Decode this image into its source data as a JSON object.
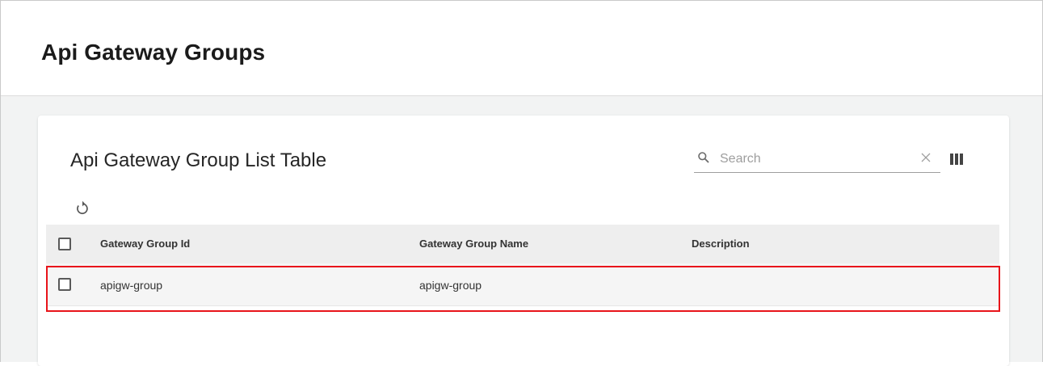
{
  "page": {
    "title": "Api Gateway Groups"
  },
  "card": {
    "title": "Api Gateway Group List Table"
  },
  "toolbar": {
    "search_placeholder": "Search",
    "search_value": "",
    "search_icon": "search-icon",
    "clear_icon": "close-icon",
    "columns_icon": "view-column-icon",
    "refresh_icon": "refresh-icon"
  },
  "table": {
    "columns": [
      "Gateway Group Id",
      "Gateway Group Name",
      "Description"
    ],
    "rows": [
      {
        "checked": false,
        "cells": [
          "apigw-group",
          "apigw-group",
          ""
        ]
      }
    ]
  },
  "colors": {
    "highlight": "#e8141a",
    "header_bg": "#eeeeee",
    "row_bg": "#f5f5f5",
    "page_bg": "#f2f3f3"
  }
}
